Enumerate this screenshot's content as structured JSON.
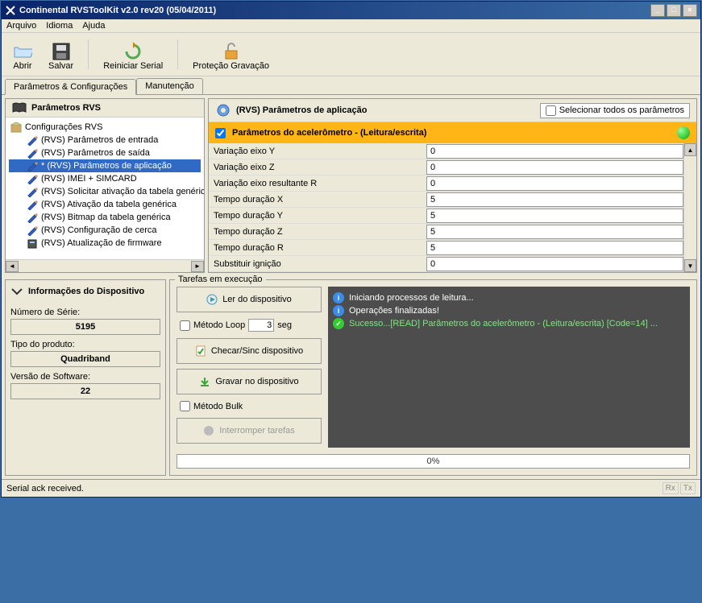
{
  "titlebar": {
    "text": "Continental RVSToolKit v2.0 rev20 (05/04/2011)"
  },
  "menu": {
    "arquivo": "Arquivo",
    "idioma": "Idioma",
    "ajuda": "Ajuda"
  },
  "toolbar": {
    "abrir": "Abrir",
    "salvar": "Salvar",
    "reiniciar": "Reiniciar Serial",
    "protecao": "Proteção Gravação"
  },
  "maintabs": {
    "params": "Parâmetros & Configurações",
    "manutencao": "Manutenção"
  },
  "tree": {
    "header": "Parâmetros RVS",
    "root": "Configurações RVS",
    "items": [
      "(RVS) Parâmetros de entrada",
      "(RVS) Parâmetros de saída",
      "* (RVS) Parâmetros de aplicação",
      "(RVS) IMEI + SIMCARD",
      "(RVS) Solicitar ativação da tabela genéric",
      "(RVS) Ativação da tabela genérica",
      "(RVS) Bitmap da tabela genérica",
      "(RVS) Configuração de cerca",
      "(RVS) Atualização de firmware"
    ],
    "selected_index": 2
  },
  "rightpanel": {
    "title": "(RVS) Parâmetros de aplicação",
    "select_all": "Selecionar todos os parâmetros",
    "group": "Parâmetros do acelerômetro - (Leitura/escrita)",
    "params": [
      {
        "label": "Variação eixo Y",
        "value": "0"
      },
      {
        "label": "Variação eixo Z",
        "value": "0"
      },
      {
        "label": "Variação eixo resultante R",
        "value": "0"
      },
      {
        "label": "Tempo duração X",
        "value": "5"
      },
      {
        "label": "Tempo duração Y",
        "value": "5"
      },
      {
        "label": "Tempo duração Z",
        "value": "5"
      },
      {
        "label": "Tempo duração R",
        "value": "5"
      },
      {
        "label": "Substituir ignição",
        "value": "0"
      }
    ]
  },
  "devinfo": {
    "header": "Informações do Dispositivo",
    "serial_label": "Número de Série:",
    "serial": "5195",
    "product_label": "Tipo do produto:",
    "product": "Quadriband",
    "sw_label": "Versão de Software:",
    "sw": "22"
  },
  "tasks": {
    "legend": "Tarefas em execução",
    "read": "Ler do dispositivo",
    "loop": "Método Loop",
    "loop_val": "3",
    "seg": "seg",
    "check": "Checar/Sinc dispositivo",
    "write": "Gravar no dispositivo",
    "bulk": "Método Bulk",
    "stop": "Interromper tarefas",
    "log": [
      {
        "icon": "info",
        "text": "Iniciando processos de leitura..."
      },
      {
        "icon": "info",
        "text": "Operações finalizadas!"
      },
      {
        "icon": "ok",
        "text": "Sucesso...[READ] Parâmetros do acelerômetro - (Leitura/escrita) [Code=14] ...",
        "class": "log-green"
      }
    ],
    "progress": "0%"
  },
  "statusbar": {
    "text": "Serial ack received.",
    "rx": "Rx",
    "tx": "Tx"
  }
}
